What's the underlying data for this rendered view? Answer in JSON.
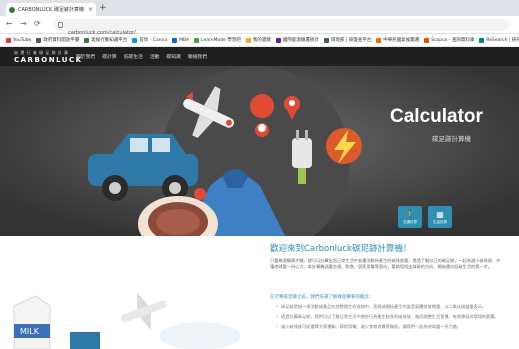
{
  "browser": {
    "tab_title": "CARBONLUCK 碳足跡計算機",
    "tab_close": "×",
    "new_tab": "+",
    "url": "carbonluck.com/calculator/",
    "bookmarks": [
      {
        "label": "YouTube",
        "color": "#e53935"
      },
      {
        "label": "政府資料開放平臺",
        "color": "#555555"
      },
      {
        "label": "氣候行動知識平台",
        "color": "#2e7d32"
      },
      {
        "label": "首頁 - Canva",
        "color": "#00a3c4"
      },
      {
        "label": "MBA",
        "color": "#1565c0"
      },
      {
        "label": "LearnMode 學習吧",
        "color": "#43a047"
      },
      {
        "label": "我的雲端",
        "color": "#f9a825"
      },
      {
        "label": "國際能源總署統計",
        "color": "#6a1b9a"
      },
      {
        "label": "環境部 | 碳盤查平台",
        "color": "#455a64"
      },
      {
        "label": "中華民國氣候變遷",
        "color": "#ef6c00"
      },
      {
        "label": "Scopus - 查詢資料庫",
        "color": "#e65100"
      },
      {
        "label": "ReSearch | 研究資源",
        "color": "#00897b"
      }
    ]
  },
  "site": {
    "logo_top": "碳 運 行 者 碳 足 跡 計 算",
    "logo_main": "CARBONLUCK",
    "nav": [
      "關於我們",
      "碳計算",
      "低碳生活",
      "活動",
      "碳知識",
      "聯絡我們"
    ]
  },
  "hero": {
    "title": "Calculator",
    "subtitle": "碳足跡計算機",
    "buttons": [
      {
        "label": "交通計算",
        "icon": "person-walk-icon"
      },
      {
        "label": "生活計算",
        "icon": "grid-icon"
      }
    ]
  },
  "content": {
    "welcome": "歡迎來到Carbonluck碳足跡計算機！",
    "paragraph": "只要幾個簡單步驟，就可以計算出您日常生活中各種活動所產生的碳排放量，透過了解自己的碳足跡，一起為減少碳排放、守護地球盡一份心力。本計算機涵蓋交通、飲食、居家用電等面向，幫助您找出減碳的方向，開始邁向低碳生活的第一步。",
    "subhead": "在計算碳足跡之前，我們先來了解幾個重要的概念：",
    "bullets": [
      "碳足跡是指一項活動或產品在其整個生命週期中，直接或間接產生的溫室氣體排放總量，以二氧化碳當量表示。",
      "透過計算碳足跡，我們可以了解日常生活中哪些行為產生較多的碳排放，進而調整生活習慣，有效降低對環境的影響。",
      "減少碳排放可從選擇大眾運輸、節約用電、減少食物浪費等做起，讓我們一起為地球盡一份力量。"
    ]
  }
}
